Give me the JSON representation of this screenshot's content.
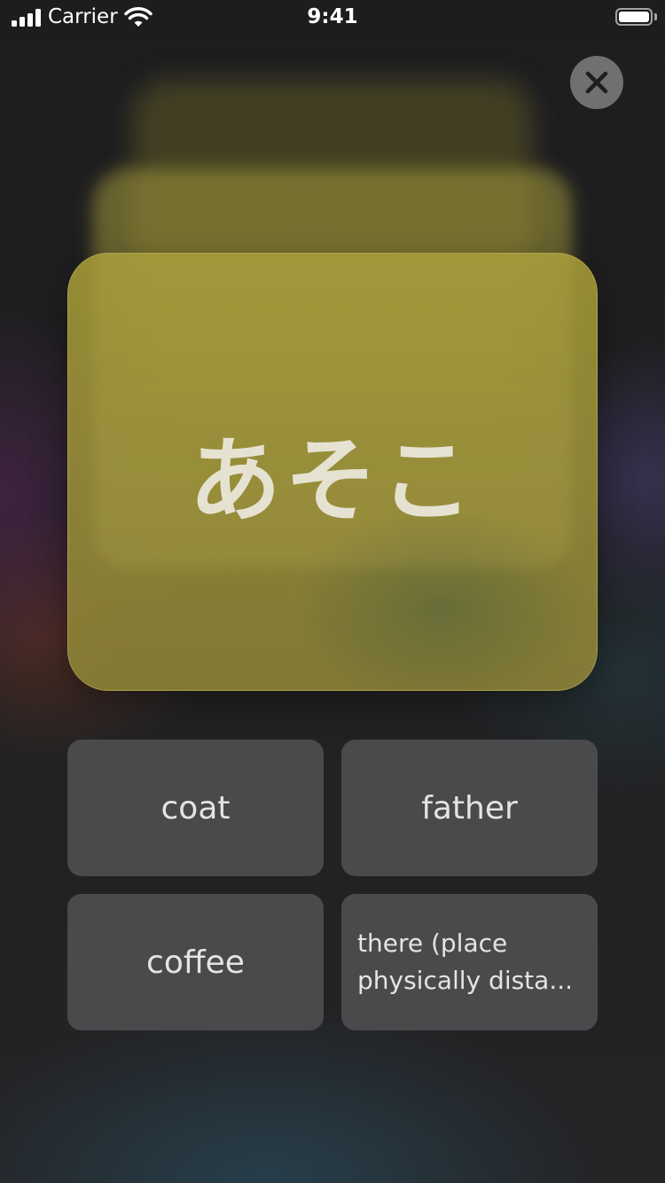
{
  "status_bar": {
    "carrier": "Carrier",
    "time": "9:41"
  },
  "close_button": {
    "icon": "close-icon"
  },
  "card": {
    "word": "あそこ",
    "color": "#a39a3a"
  },
  "answers": [
    {
      "label": "coat"
    },
    {
      "label": "father"
    },
    {
      "label": "coffee"
    },
    {
      "label_line1": "there (place",
      "label_line2": "physically dista..."
    }
  ]
}
